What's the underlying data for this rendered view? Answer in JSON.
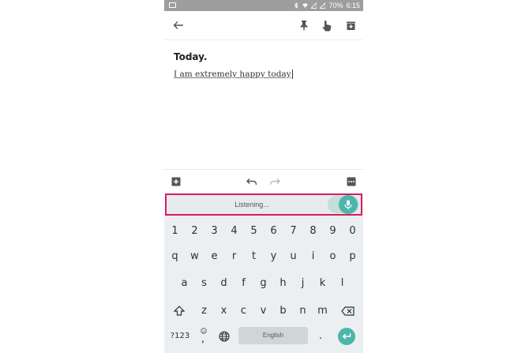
{
  "status_bar": {
    "battery": "70%",
    "time": "6:15"
  },
  "app_bar": {
    "back_icon": "arrow-back-icon",
    "pin_icon": "pin-icon",
    "reminder_icon": "hand-pointer-icon",
    "archive_icon": "archive-icon"
  },
  "note": {
    "title": "Today.",
    "body": "I am extremely happy today"
  },
  "editor_toolbar": {
    "add_icon": "add-box-icon",
    "undo_icon": "undo-icon",
    "redo_icon": "redo-icon",
    "more_icon": "more-icon"
  },
  "voice": {
    "status": "Listening...",
    "accent": "#4db6ac",
    "highlight": "#d81b60"
  },
  "keyboard": {
    "number_row": [
      "1",
      "2",
      "3",
      "4",
      "5",
      "6",
      "7",
      "8",
      "9",
      "0"
    ],
    "row1": [
      "q",
      "w",
      "e",
      "r",
      "t",
      "y",
      "u",
      "i",
      "o",
      "p"
    ],
    "row2": [
      "a",
      "s",
      "d",
      "f",
      "g",
      "h",
      "j",
      "k",
      "l"
    ],
    "row3": [
      "z",
      "x",
      "c",
      "v",
      "b",
      "n",
      "m"
    ],
    "symbols_label": "?123",
    "emoji_comma": ",",
    "space_label": "English",
    "period": "."
  }
}
